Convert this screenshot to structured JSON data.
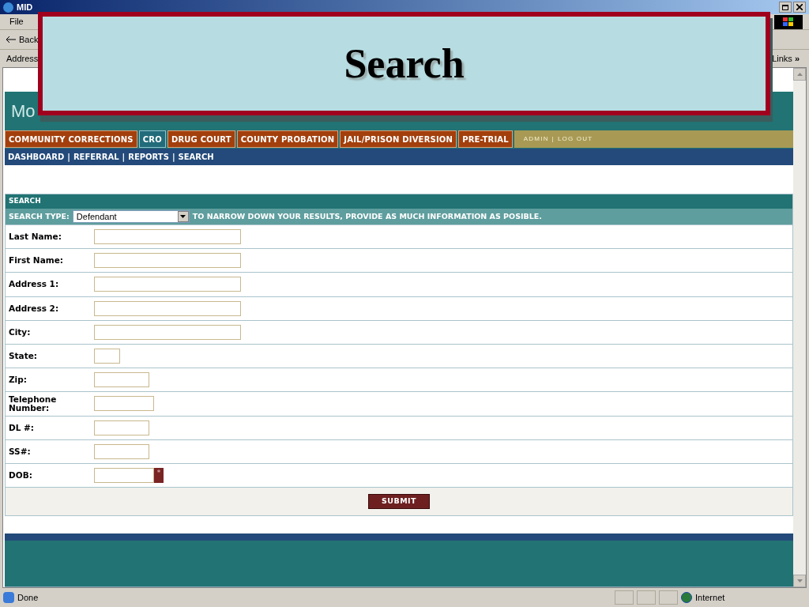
{
  "slide_title": "Search",
  "window": {
    "title": "MID"
  },
  "menu": [
    "File"
  ],
  "toolbar": {
    "back": "Back"
  },
  "address_bar": {
    "label": "Address",
    "links": "Links",
    "more": "»"
  },
  "site": {
    "logo": "Mo"
  },
  "programs": [
    {
      "label": "COMMUNITY CORRECTIONS",
      "selected": false
    },
    {
      "label": "CRO",
      "selected": true
    },
    {
      "label": "DRUG COURT",
      "selected": false
    },
    {
      "label": "COUNTY PROBATION",
      "selected": false
    },
    {
      "label": "JAIL/PRISON DIVERSION",
      "selected": false
    },
    {
      "label": "PRE-TRIAL",
      "selected": false
    }
  ],
  "account_links": [
    "ADMIN",
    "LOG OUT"
  ],
  "account_separator": "|",
  "subnav_separator": "|",
  "subnav": [
    "DASHBOARD",
    "REFERRAL",
    "REPORTS",
    "SEARCH"
  ],
  "search": {
    "heading": "SEARCH",
    "type_label": "SEARCH TYPE:",
    "type_value": "Defendant",
    "hint": "TO NARROW DOWN YOUR RESULTS, PROVIDE AS MUCH INFORMATION AS POSIBLE.",
    "fields": [
      {
        "label": "Last Name:",
        "kind": "long"
      },
      {
        "label": "First Name:",
        "kind": "long"
      },
      {
        "label": "Address 1:",
        "kind": "long"
      },
      {
        "label": "Address 2:",
        "kind": "long"
      },
      {
        "label": "City:",
        "kind": "long"
      },
      {
        "label": "State:",
        "kind": "tiny"
      },
      {
        "label": "Zip:",
        "kind": "short"
      },
      {
        "label": "Telephone Number:",
        "kind": "medium"
      },
      {
        "label": "DL #:",
        "kind": "short"
      },
      {
        "label": "SS#:",
        "kind": "short"
      },
      {
        "label": "DOB:",
        "kind": "date",
        "marker": "*"
      }
    ],
    "submit": "SUBMIT"
  },
  "status_bar": {
    "text": "Done",
    "zone": "Internet"
  }
}
